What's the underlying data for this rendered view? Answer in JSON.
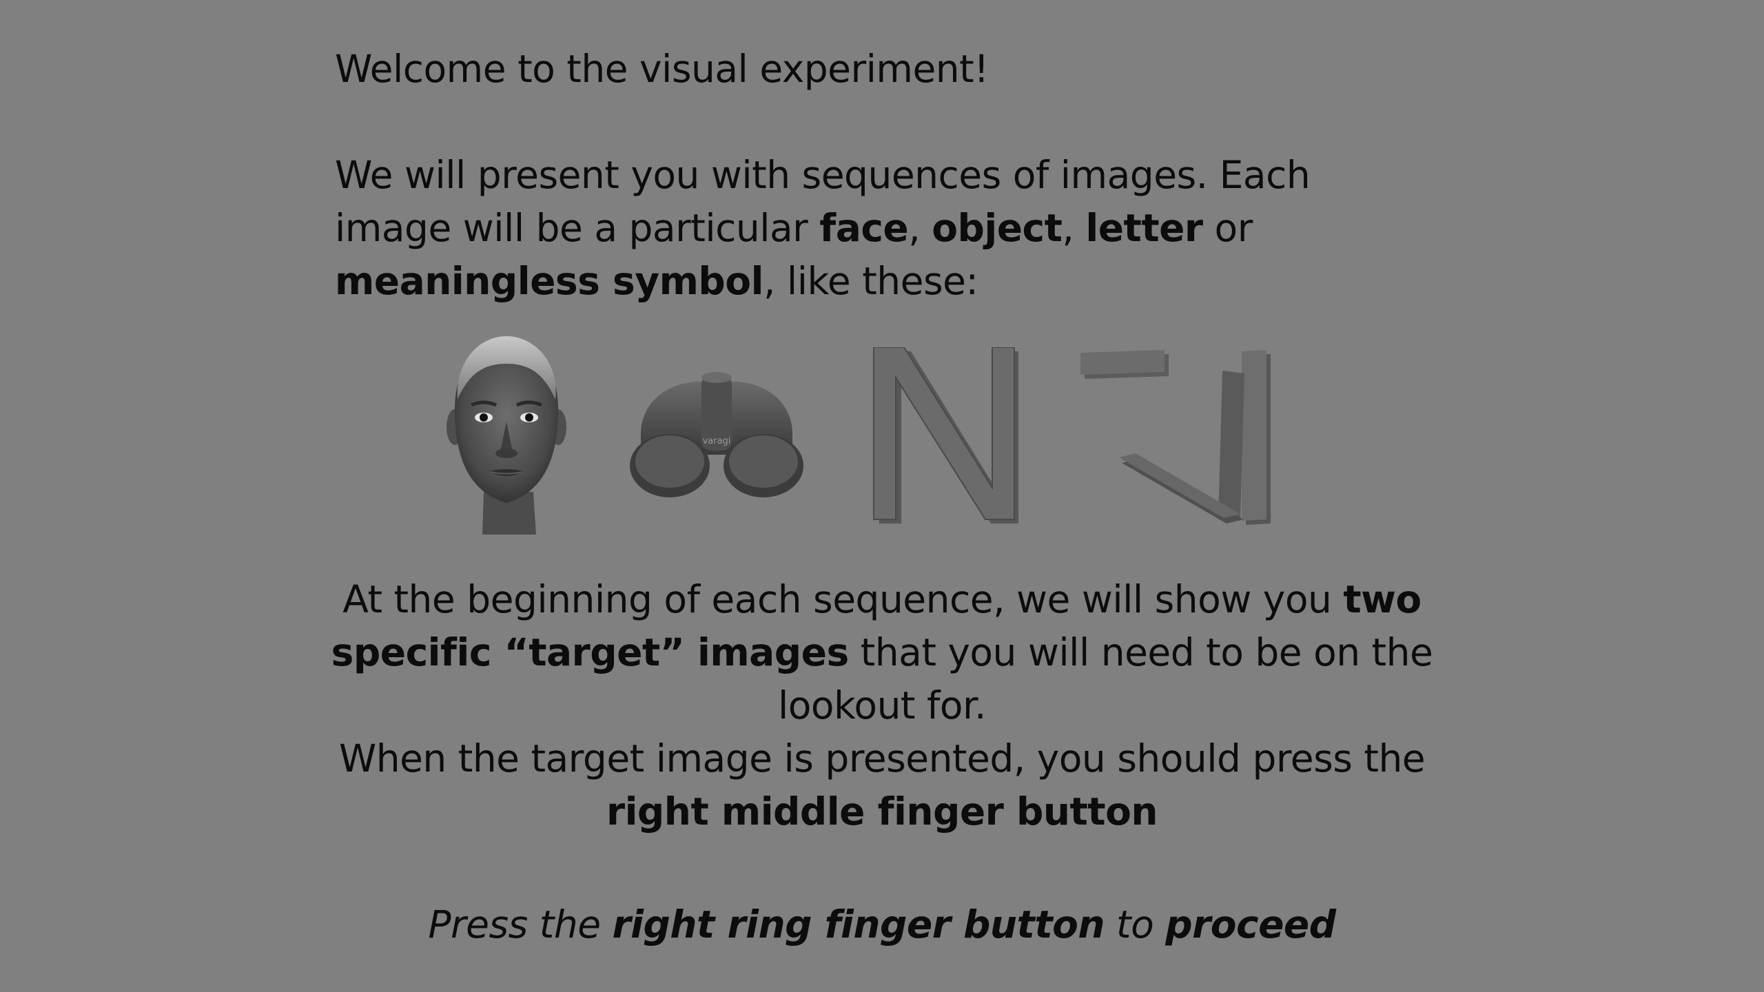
{
  "welcome": {
    "text": "Welcome to the visual experiment!"
  },
  "intro": {
    "part1": "We will present you with sequences of images. Each image will be a particular ",
    "category1": "face",
    "sep1": ", ",
    "category2": "object",
    "sep2": ", ",
    "category3": "letter",
    "sep3": " or ",
    "category4": "meaningless symbol",
    "part2": ", like these:"
  },
  "stimuli": [
    {
      "icon": "face-stimulus-icon",
      "label": "face"
    },
    {
      "icon": "binoculars-stimulus-icon",
      "label": "object"
    },
    {
      "icon": "letter-n-stimulus-icon",
      "label": "letter"
    },
    {
      "icon": "symbol-stimulus-icon",
      "label": "meaningless symbol"
    }
  ],
  "object_brand": "varagi",
  "stimulus_letter": "N",
  "target_instructions": {
    "line1_a": "At the beginning of each sequence, we will show you ",
    "line1_bold": "two specific “target” images",
    "line1_b": " that you will need to be on the lookout for.",
    "line2_a": "When the target image is presented, you should press the ",
    "line2_bold": "right middle finger button"
  },
  "proceed": {
    "a": "Press the ",
    "bold1": "right ring finger button",
    "b": " to ",
    "bold2": "proceed"
  },
  "colors": {
    "background": "#808080",
    "text": "#0c0c0c"
  }
}
